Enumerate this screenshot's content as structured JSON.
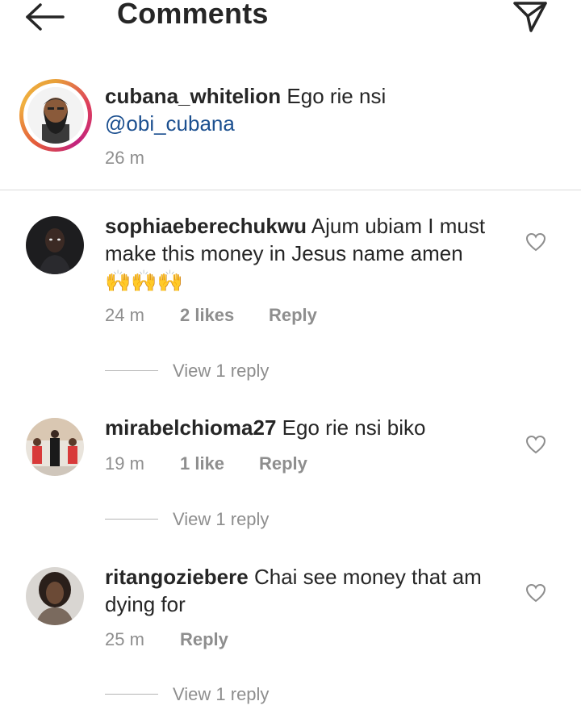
{
  "header": {
    "title": "Comments",
    "back_icon": "arrow-left-icon",
    "send_icon": "paper-plane-icon"
  },
  "caption": {
    "username": "cubana_whitelion",
    "text": "Ego rie nsi",
    "mention": "@obi_cubana",
    "time": "26 m"
  },
  "comments": [
    {
      "username": "sophiaeberechukwu",
      "text_line1": "Ajum ubiam I must",
      "text_line2": "make this money in Jesus name amen",
      "text_line3": "🙌🙌🙌",
      "time": "24 m",
      "likes": "2 likes",
      "reply": "Reply",
      "view_replies": "View 1 reply"
    },
    {
      "username": "mirabelchioma27",
      "text_line1": "Ego rie nsi biko",
      "time": "19 m",
      "likes": "1 like",
      "reply": "Reply",
      "view_replies": "View 1 reply"
    },
    {
      "username": "ritangoziebere",
      "text_line1": "Chai see money that am",
      "text_line2": "dying for",
      "time": "25 m",
      "reply": "Reply",
      "view_replies": "View 1 reply"
    }
  ],
  "colors": {
    "text": "#262626",
    "meta": "#8e8e8e",
    "mention": "#1b4f8f",
    "divider": "#dbdbdb",
    "story_ring_start": "#e8a038",
    "story_ring_end": "#c2237e"
  }
}
